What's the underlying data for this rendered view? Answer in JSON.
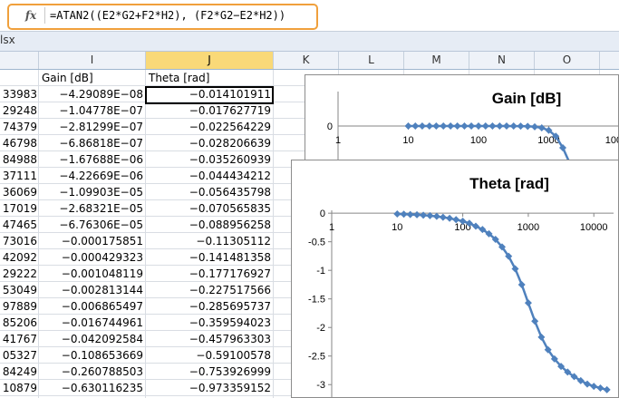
{
  "formula_bar": {
    "fx_label": "fx",
    "formula": "=ATAN2((E2*G2+F2*H2), (F2*G2−E2*H2))"
  },
  "tab_strip": {
    "label": "lsx"
  },
  "columns": [
    "I",
    "J",
    "K",
    "L",
    "M",
    "N",
    "O"
  ],
  "selected_column": "J",
  "header_row": {
    "h": "",
    "i": "Gain [dB]",
    "j": "Theta [rad]"
  },
  "rows": [
    {
      "h": "33983",
      "i": "−4.29089E−08",
      "j": "−0.014101911"
    },
    {
      "h": "29248",
      "i": "−1.04778E−07",
      "j": "−0.017627719"
    },
    {
      "h": "74379",
      "i": "−2.81299E−07",
      "j": "−0.022564229"
    },
    {
      "h": "46798",
      "i": "−6.86818E−07",
      "j": "−0.028206639"
    },
    {
      "h": "84988",
      "i": "−1.67688E−06",
      "j": "−0.035260939"
    },
    {
      "h": "37111",
      "i": "−4.22669E−06",
      "j": "−0.044434212"
    },
    {
      "h": "36069",
      "i": "−1.09903E−05",
      "j": "−0.056435798"
    },
    {
      "h": "17019",
      "i": "−2.68321E−05",
      "j": "−0.070565835"
    },
    {
      "h": "47465",
      "i": "−6.76306E−05",
      "j": "−0.088956258"
    },
    {
      "h": "73016",
      "i": "−0.000175851",
      "j": "−0.11305112"
    },
    {
      "h": "42092",
      "i": "−0.000429323",
      "j": "−0.141481358"
    },
    {
      "h": "29222",
      "i": "−0.001048119",
      "j": "−0.177176927"
    },
    {
      "h": "53049",
      "i": "−0.002813144",
      "j": "−0.227517566"
    },
    {
      "h": "97889",
      "i": "−0.006865497",
      "j": "−0.285695737"
    },
    {
      "h": "85206",
      "i": "−0.016744961",
      "j": "−0.359594023"
    },
    {
      "h": "41767",
      "i": "−0.042092584",
      "j": "−0.457963303"
    },
    {
      "h": "05327",
      "i": "−0.108653669",
      "j": "−0.59100578"
    },
    {
      "h": "84249",
      "i": "−0.260788503",
      "j": "−0.753926999"
    },
    {
      "h": "10879",
      "i": "−0.630116235",
      "j": "−0.973359152"
    }
  ],
  "chart_data": [
    {
      "type": "scatter",
      "title": "Gain [dB]",
      "x_scale": "log",
      "xlim": [
        1,
        10000
      ],
      "x_ticks": [
        "1",
        "10",
        "100",
        "1000",
        "10000"
      ],
      "y_ticks": [
        "0"
      ],
      "series": [
        {
          "color": "#4f81bd",
          "marker": "diamond",
          "points": [
            [
              10,
              0
            ],
            [
              12.6,
              0
            ],
            [
              15.8,
              0
            ],
            [
              20,
              0
            ],
            [
              25,
              0
            ],
            [
              31.6,
              0
            ],
            [
              40,
              0
            ],
            [
              50,
              0
            ],
            [
              63,
              0
            ],
            [
              79,
              0
            ],
            [
              100,
              0
            ],
            [
              126,
              0
            ],
            [
              158,
              0
            ],
            [
              200,
              -0.001
            ],
            [
              251,
              -0.003
            ],
            [
              316,
              -0.007
            ],
            [
              398,
              -0.017
            ],
            [
              501,
              -0.042
            ],
            [
              631,
              -0.109
            ],
            [
              794,
              -0.261
            ],
            [
              1000,
              -0.63
            ],
            [
              1259,
              -1.5
            ],
            [
              1585,
              -3.2
            ],
            [
              2000,
              -5.5
            ]
          ]
        }
      ]
    },
    {
      "type": "scatter",
      "title": "Theta [rad]",
      "x_scale": "log",
      "xlim": [
        1,
        20000
      ],
      "ylim": [
        -3.25,
        0.05
      ],
      "x_ticks": [
        "1",
        "10",
        "100",
        "1000",
        "10000"
      ],
      "y_ticks": [
        "0",
        "-0.5",
        "-1",
        "-1.5",
        "-2",
        "-2.5",
        "-3"
      ],
      "series": [
        {
          "color": "#4f81bd",
          "marker": "diamond",
          "points": [
            [
              10,
              -0.014
            ],
            [
              12.6,
              -0.018
            ],
            [
              15.8,
              -0.023
            ],
            [
              20,
              -0.028
            ],
            [
              25,
              -0.035
            ],
            [
              31.6,
              -0.044
            ],
            [
              40,
              -0.056
            ],
            [
              50,
              -0.071
            ],
            [
              63,
              -0.089
            ],
            [
              79,
              -0.113
            ],
            [
              100,
              -0.141
            ],
            [
              126,
              -0.177
            ],
            [
              158,
              -0.228
            ],
            [
              200,
              -0.286
            ],
            [
              251,
              -0.36
            ],
            [
              316,
              -0.458
            ],
            [
              398,
              -0.591
            ],
            [
              501,
              -0.754
            ],
            [
              631,
              -0.973
            ],
            [
              794,
              -1.25
            ],
            [
              1000,
              -1.571
            ],
            [
              1259,
              -1.89
            ],
            [
              1585,
              -2.17
            ],
            [
              2000,
              -2.39
            ],
            [
              2512,
              -2.55
            ],
            [
              3162,
              -2.68
            ],
            [
              3981,
              -2.78
            ],
            [
              5012,
              -2.86
            ],
            [
              6310,
              -2.93
            ],
            [
              7943,
              -2.99
            ],
            [
              10000,
              -3.03
            ],
            [
              12589,
              -3.06
            ],
            [
              15849,
              -3.09
            ]
          ]
        }
      ]
    }
  ]
}
